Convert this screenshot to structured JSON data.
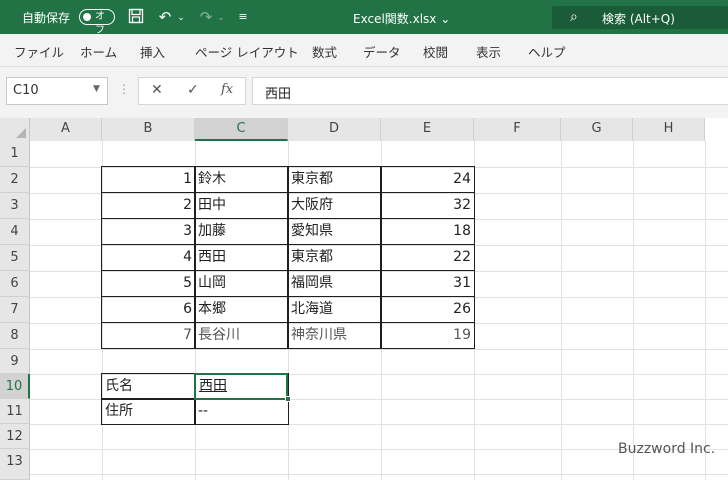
{
  "titlebar": {
    "autosave_label": "自動保存",
    "autosave_state": "オフ",
    "filename": "Excel関数.xlsx",
    "filename_dropdown": "⌄",
    "search_text": "検索 (Alt+Q)",
    "bg_color": "#217346"
  },
  "ribbon": {
    "tabs": [
      "ファイル",
      "ホーム",
      "挿入",
      "ページ レイアウト",
      "数式",
      "データ",
      "校閲",
      "表示",
      "ヘルプ"
    ]
  },
  "formula_bar": {
    "name_box": "C10",
    "fx": "fx",
    "value": "西田"
  },
  "sheet": {
    "columns": [
      "A",
      "B",
      "C",
      "D",
      "E",
      "F",
      "G",
      "H"
    ],
    "rows": [
      "1",
      "2",
      "3",
      "4",
      "5",
      "6",
      "7",
      "8",
      "9",
      "10",
      "11",
      "12",
      "13"
    ],
    "table": [
      {
        "no": "1",
        "name": "鈴木",
        "pref": "東京都",
        "age": "24"
      },
      {
        "no": "2",
        "name": "田中",
        "pref": "大阪府",
        "age": "32"
      },
      {
        "no": "3",
        "name": "加藤",
        "pref": "愛知県",
        "age": "18"
      },
      {
        "no": "4",
        "name": "西田",
        "pref": "東京都",
        "age": "22"
      },
      {
        "no": "5",
        "name": "山岡",
        "pref": "福岡県",
        "age": "31"
      },
      {
        "no": "6",
        "name": "本郷",
        "pref": "北海道",
        "age": "26"
      },
      {
        "no": "7",
        "name": "長谷川",
        "pref": "神奈川県",
        "age": "19"
      }
    ],
    "b10": "氏名",
    "c10": "西田",
    "b11": "住所",
    "c11": "--",
    "selected_cell": "C10",
    "accent_color": "#217346"
  },
  "watermark": "Buzzword Inc."
}
